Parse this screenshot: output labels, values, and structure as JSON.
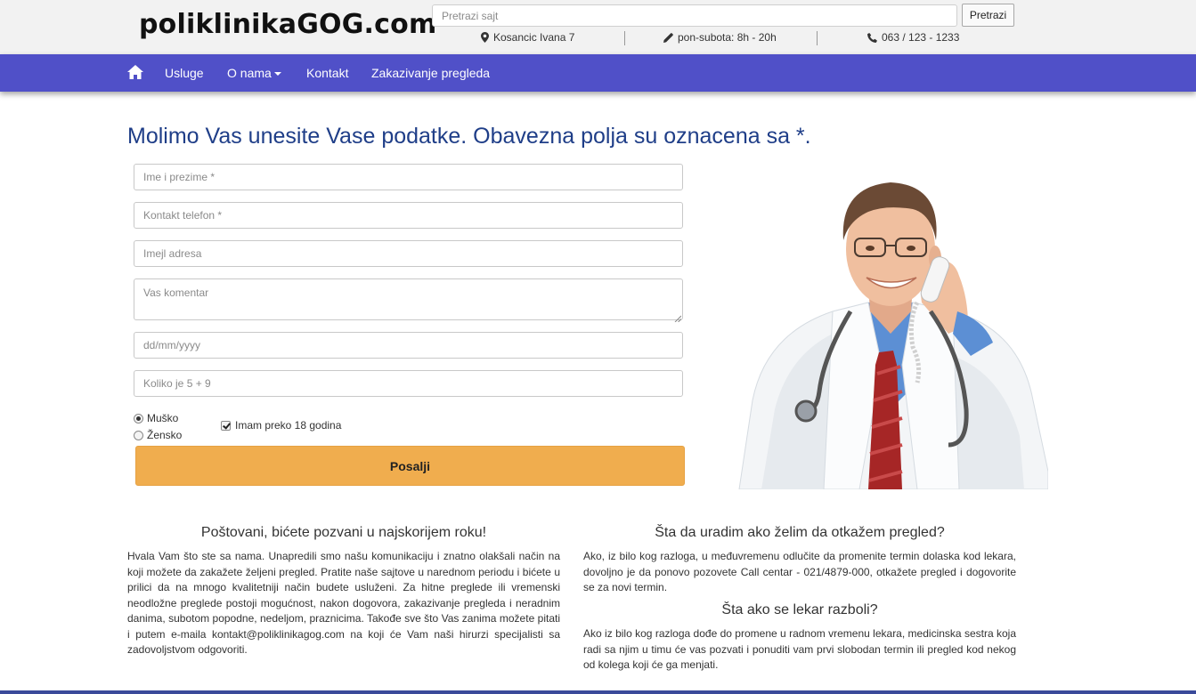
{
  "header": {
    "logo": "poliklinikaGOG.com",
    "search": {
      "placeholder": "Pretrazi sajt",
      "button_label": "Pretrazi"
    },
    "address": "Kosancic Ivana 7",
    "hours": "pon-subota: 8h - 20h",
    "phone": "063 / 123 - 1233"
  },
  "nav": {
    "items": [
      "Usluge",
      "O nama",
      "Kontakt",
      "Zakazivanje pregleda"
    ]
  },
  "form": {
    "title": "Molimo Vas unesite Vase podatke. Obavezna polja su oznacena sa *.",
    "placeholders": {
      "name": "Ime i prezime *",
      "phone": "Kontakt telefon *",
      "email": "Imejl adresa",
      "comment": "Vas komentar",
      "date": "dd/mm/yyyy",
      "captcha": "Koliko je 5 + 9"
    },
    "gender": {
      "male": "Muško",
      "female": "Žensko",
      "selected": "male"
    },
    "adult_label": "Imam preko 18 godina",
    "adult_checked": true,
    "submit_label": "Posalji"
  },
  "sections": {
    "left_title": "Poštovani, bićete pozvani u najskorijem roku!",
    "left_text": "Hvala Vam što ste sa nama. Unapredili smo našu komunikaciju i znatno olakšali način na koji možete da zakažete željeni pregled. Pratite naše sajtove u narednom periodu i bićete u prilici da na mnogo kvalitetniji način budete usluženi. Za hitne preglede ili vremenski neodložne preglede postoji mogućnost, nakon dogovora, zakazivanje pregleda i neradnim danima, subotom popodne, nedeljom, praznicima. Takođe sve što Vas zanima možete pitati i putem e-maila kontakt@poliklinikagog.com na koji će Vam naši hirurzi specijalisti sa zadovoljstvom odgovoriti.",
    "right_title": "Šta da uradim ako želim da otkažem pregled?",
    "right_text": "Ako, iz bilo kog razloga, u međuvremenu odlučite da promenite termin dolaska kod lekara, dovoljno je da ponovo pozovete Call centar - 021/4879-000, otkažete pregled i dogovorite se za novi termin.",
    "right_title2": "Šta ako se lekar razboli?",
    "right_text2": "Ako iz bilo kog razloga dođe do promene u radnom vremenu lekara, medicinska sestra koja radi sa njim u timu će vas pozvati i ponuditi vam prvi slobodan termin ili pregled kod nekog od kolega koji će ga menjati."
  }
}
